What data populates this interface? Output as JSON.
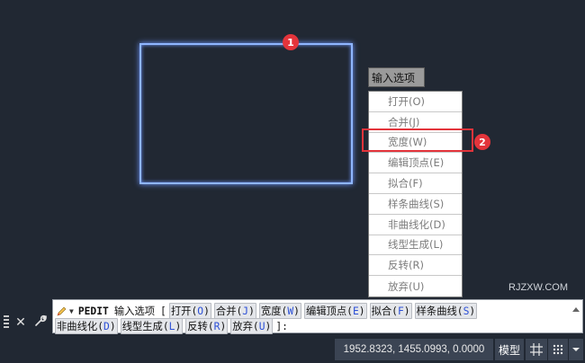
{
  "drawing": {
    "badge1": "1",
    "badge2": "2",
    "watermark": "RJZXW.COM"
  },
  "dynamic_menu": {
    "title": "输入选项",
    "items": [
      "打开(O)",
      "合并(J)",
      "宽度(W)",
      "编辑顶点(E)",
      "拟合(F)",
      "样条曲线(S)",
      "非曲线化(D)",
      "线型生成(L)",
      "反转(R)",
      "放弃(U)"
    ],
    "highlighted_item": "宽度(W)"
  },
  "command_line": {
    "command": "PEDIT",
    "prompt": "输入选项",
    "open_bracket": "[",
    "options": [
      {
        "label": "打开(",
        "key": "O",
        "end": ")"
      },
      {
        "label": "合并(",
        "key": "J",
        "end": ")"
      },
      {
        "label": "宽度(",
        "key": "W",
        "end": ")"
      },
      {
        "label": "编辑顶点(",
        "key": "E",
        "end": ")"
      },
      {
        "label": "拟合(",
        "key": "F",
        "end": ")"
      },
      {
        "label": "样条曲线(",
        "key": "S",
        "end": ")"
      },
      {
        "label": "非曲线化(",
        "key": "D",
        "end": ")"
      },
      {
        "label": "线型生成(",
        "key": "L",
        "end": ")"
      },
      {
        "label": "反转(",
        "key": "R",
        "end": ")"
      },
      {
        "label": "放弃(",
        "key": "U",
        "end": ")"
      }
    ],
    "close_suffix": "]:",
    "close_icon": "✕",
    "customize_icon": "wrench-icon"
  },
  "status_bar": {
    "coordinates": "1952.8323, 1455.0993, 0.0000",
    "model_tab": "模型",
    "icons": [
      "grid-icon",
      "snap-icon",
      "menu-down-icon"
    ]
  },
  "colors": {
    "canvas_bg": "#212833",
    "selection": "#8fb6ff",
    "badge": "#e3343b",
    "option_key": "#2b4fd6"
  }
}
